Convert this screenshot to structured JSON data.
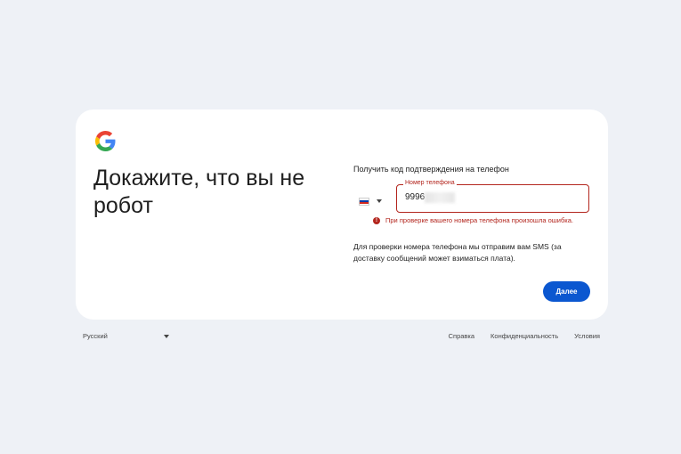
{
  "heading": "Докажите, что вы не робот",
  "subtitle": "Получить код подтверждения на телефон",
  "country": {
    "flag": "russia-flag"
  },
  "phone": {
    "label": "Номер телефона",
    "value": "9996"
  },
  "error": "При проверке вашего номера телефона произошла ошибка.",
  "info": "Для проверки номера телефона мы отправим вам SMS (за доставку сообщений может взиматься плата).",
  "next_label": "Далее",
  "footer": {
    "language": "Русский",
    "links": [
      "Справка",
      "Конфиденциальность",
      "Условия"
    ]
  },
  "colors": {
    "error": "#b3261e",
    "primary": "#0b57d0",
    "background": "#eef1f6"
  }
}
